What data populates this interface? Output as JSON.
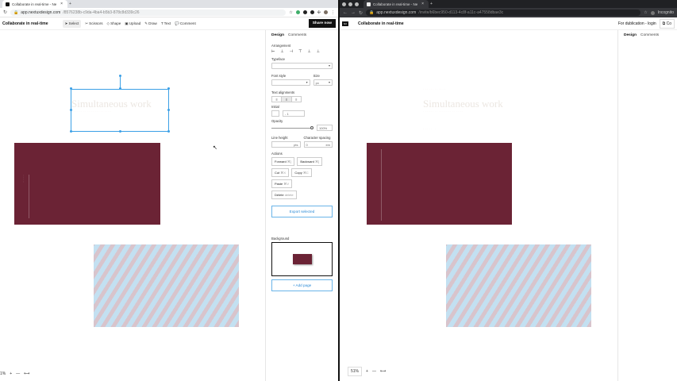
{
  "left_window": {
    "tab_title": "Collaborate in real-time - Nex",
    "url_domain": "app.nextuxdesign.com",
    "url_path": "/8576238b-c9da-4ba4-b5b3-878c8d339c26",
    "app_title": "Collaborate in real-time",
    "toolbar": {
      "select": "Select",
      "scissors": "Scissors",
      "shape": "Shape",
      "upload": "Upload",
      "draw": "Draw",
      "text": "Text",
      "comment": "Comment",
      "share": "Share now"
    },
    "canvas": {
      "heading": "Simultaneous work",
      "zoom": "1%",
      "zoom_in": "+",
      "zoom_out": "—",
      "fit": "⟷"
    },
    "panel": {
      "tab_design": "Design",
      "tab_comments": "Comments",
      "arrangement": "Arrangement",
      "typeface": "Typeface",
      "font_style": "Font style",
      "size": "Size",
      "size_value": "px",
      "text_alignments": "Text alignments",
      "initial": "Initial",
      "initial_value": "- 1",
      "opacity": "Opacity",
      "opacity_value": "100%",
      "line_height": "Line height",
      "line_height_unit": "pts",
      "character_spacing": "Character spacing",
      "character_spacing_value": "0",
      "character_spacing_unit": "em",
      "actions": "Actions",
      "forward": "Forward",
      "forward_key": "⌘]",
      "backward": "Backward",
      "backward_key": "⌘[",
      "cut": "Cut",
      "cut_key": "⌘X",
      "copy": "Copy",
      "copy_key": "⌘C",
      "paste": "Paste",
      "paste_key": "⌘V",
      "delete": "Delete",
      "delete_key": "delete",
      "export": "Export selected",
      "background": "Background",
      "add_page": "+ Add page"
    }
  },
  "right_window": {
    "tab_title": "Collaborate in real-time - Nex",
    "url_domain": "app.nextuxdesign.com",
    "url_path": "/invite/b6bec950-d113-4c8f-a11c-a47558dbae3c",
    "app_title": "Collaborate in real-time",
    "for_duplication": "For dublication - login",
    "profile": "Incognito",
    "canvas": {
      "heading": "Simultaneous work",
      "zoom": "51%",
      "zoom_in": "+",
      "zoom_out": "—",
      "fit": "⟷"
    },
    "panel": {
      "tab_design": "Design",
      "tab_comments": "Comments"
    },
    "copy_button": "Co"
  },
  "colors": {
    "maroon": "#6b2335",
    "selection_blue": "#3ba0e6",
    "stripe_pink": "#d8c4cc",
    "stripe_blue": "#c3e0f1"
  }
}
